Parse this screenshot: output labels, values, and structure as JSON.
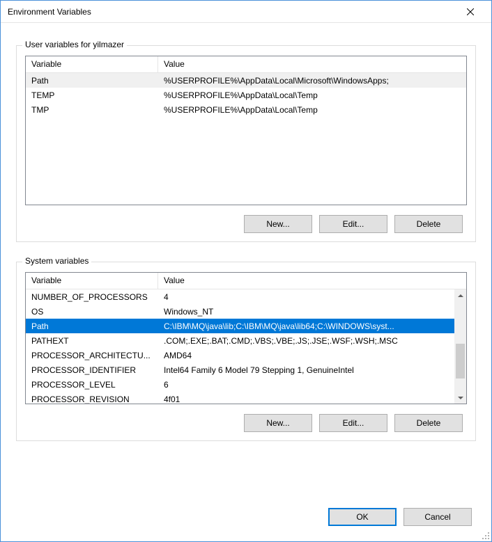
{
  "title": "Environment Variables",
  "userGroup": {
    "label": "User variables for yilmazer",
    "headers": {
      "variable": "Variable",
      "value": "Value"
    },
    "rows": [
      {
        "variable": "Path",
        "value": "%USERPROFILE%\\AppData\\Local\\Microsoft\\WindowsApps;",
        "selected": "inactive"
      },
      {
        "variable": "TEMP",
        "value": "%USERPROFILE%\\AppData\\Local\\Temp"
      },
      {
        "variable": "TMP",
        "value": "%USERPROFILE%\\AppData\\Local\\Temp"
      }
    ],
    "buttons": {
      "new": "New...",
      "edit": "Edit...",
      "delete": "Delete"
    }
  },
  "systemGroup": {
    "label": "System variables",
    "headers": {
      "variable": "Variable",
      "value": "Value"
    },
    "rows": [
      {
        "variable": "NUMBER_OF_PROCESSORS",
        "value": "4"
      },
      {
        "variable": "OS",
        "value": "Windows_NT"
      },
      {
        "variable": "Path",
        "value": "C:\\IBM\\MQ\\java\\lib;C:\\IBM\\MQ\\java\\lib64;C:\\WINDOWS\\syst...",
        "selected": "active"
      },
      {
        "variable": "PATHEXT",
        "value": ".COM;.EXE;.BAT;.CMD;.VBS;.VBE;.JS;.JSE;.WSF;.WSH;.MSC"
      },
      {
        "variable": "PROCESSOR_ARCHITECTU...",
        "value": "AMD64"
      },
      {
        "variable": "PROCESSOR_IDENTIFIER",
        "value": "Intel64 Family 6 Model 79 Stepping 1, GenuineIntel"
      },
      {
        "variable": "PROCESSOR_LEVEL",
        "value": "6"
      },
      {
        "variable": "PROCESSOR_REVISION",
        "value": "4f01"
      }
    ],
    "buttons": {
      "new": "New...",
      "edit": "Edit...",
      "delete": "Delete"
    }
  },
  "footer": {
    "ok": "OK",
    "cancel": "Cancel"
  }
}
